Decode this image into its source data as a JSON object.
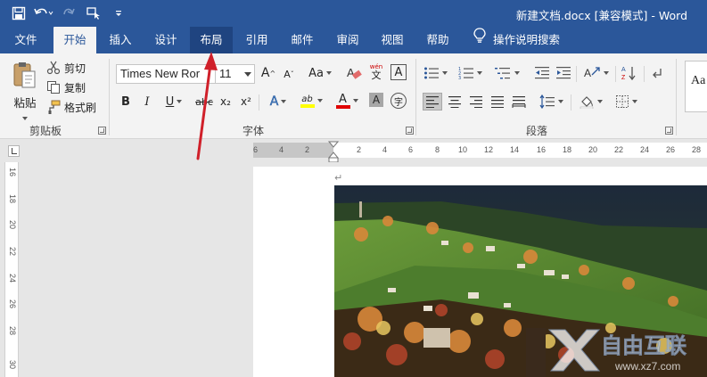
{
  "titlebar": {
    "title": "新建文档.docx [兼容模式] - Word",
    "qat": [
      "save-icon",
      "undo-icon",
      "redo-icon",
      "touch-mode-icon",
      "customize-icon"
    ]
  },
  "tabs": [
    {
      "label": "文件"
    },
    {
      "label": "开始"
    },
    {
      "label": "插入"
    },
    {
      "label": "设计"
    },
    {
      "label": "布局"
    },
    {
      "label": "引用"
    },
    {
      "label": "邮件"
    },
    {
      "label": "审阅"
    },
    {
      "label": "视图"
    },
    {
      "label": "帮助"
    }
  ],
  "tellme": {
    "label": "操作说明搜索"
  },
  "clipboard": {
    "paste": "粘贴",
    "cut": "剪切",
    "copy": "复制",
    "format_painter": "格式刷",
    "group_label": "剪贴板"
  },
  "font": {
    "name": "Times New Ror",
    "size": "11",
    "group_label": "字体",
    "change_case": "Aa",
    "wen": "wén",
    "wen_char": "文",
    "bold": "B",
    "italic": "I",
    "underline": "U",
    "strike": "abc",
    "sub": "x₂",
    "sup": "x²",
    "effects": "A",
    "highlight": "ab",
    "font_color": "A",
    "shade": "A",
    "enclose": "字",
    "grow": "A",
    "shrink": "A",
    "highlight_color": "#ffff00",
    "font_color_value": "#e00000"
  },
  "paragraph": {
    "group_label": "段落"
  },
  "styles": {
    "preview": "Aa"
  },
  "ruler": {
    "h_numbers": [
      "6",
      "4",
      "2",
      "2",
      "4",
      "6",
      "8",
      "10",
      "12",
      "14",
      "16",
      "18",
      "20",
      "22",
      "24",
      "26",
      "28"
    ],
    "v_numbers": [
      "16",
      "18",
      "20",
      "22",
      "24",
      "26",
      "28",
      "30"
    ]
  },
  "document": {
    "para_mark": "↵"
  },
  "watermark": {
    "brand": "自由互联",
    "url": "www.xz7.com"
  },
  "colors": {
    "accent": "#2b579a",
    "ribbon": "#f3f3f3",
    "arrow": "#d0202a"
  }
}
